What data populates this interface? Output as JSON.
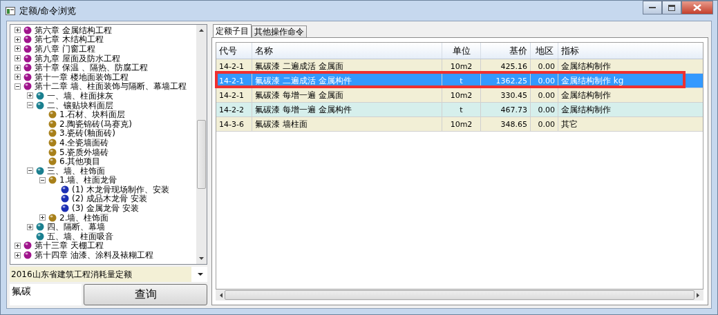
{
  "window": {
    "title": "定额/命令浏览"
  },
  "tree": [
    {
      "label": "第六章 金属结构工程",
      "kind": "chapter",
      "expanded": false
    },
    {
      "label": "第七章 木结构工程",
      "kind": "chapter",
      "expanded": false
    },
    {
      "label": "第八章 门窗工程",
      "kind": "chapter",
      "expanded": false
    },
    {
      "label": "第九章 屋面及防水工程",
      "kind": "chapter",
      "expanded": false
    },
    {
      "label": "第十章 保温 、隔热、防腐工程",
      "kind": "chapter",
      "expanded": false
    },
    {
      "label": "第十一章 楼地面装饰工程",
      "kind": "chapter",
      "expanded": false
    },
    {
      "label": "第十二章 墙、柱面装饰与隔断、幕墙工程",
      "kind": "chapter",
      "expanded": true,
      "children": [
        {
          "label": "一、墙、柱面抹灰",
          "kind": "section",
          "expanded": false
        },
        {
          "label": "二、镶贴块料面层",
          "kind": "section",
          "expanded": true,
          "children": [
            {
              "label": "1.石材、块料面层",
              "kind": "group"
            },
            {
              "label": "2.陶瓷锦砖(马赛克)",
              "kind": "group"
            },
            {
              "label": "3.瓷砖(釉面砖)",
              "kind": "group"
            },
            {
              "label": "4.全瓷墙面砖",
              "kind": "group"
            },
            {
              "label": "5.瓷质外墙砖",
              "kind": "group"
            },
            {
              "label": "6.其他项目",
              "kind": "group"
            }
          ]
        },
        {
          "label": "三、墙、柱饰面",
          "kind": "section",
          "expanded": true,
          "children": [
            {
              "label": "1.墙、柱面龙骨",
              "kind": "group",
              "expanded": true,
              "children": [
                {
                  "label": "(1) 木龙骨现场制作、安装",
                  "kind": "item"
                },
                {
                  "label": "(2) 成品木龙骨 安装",
                  "kind": "item"
                },
                {
                  "label": "(3) 金属龙骨 安装",
                  "kind": "item"
                }
              ]
            },
            {
              "label": "2.墙、柱饰面",
              "kind": "group",
              "expanded": false
            }
          ]
        },
        {
          "label": "四、隔断、幕墙",
          "kind": "section",
          "expanded": false
        },
        {
          "label": "五、墙、柱面吸音",
          "kind": "section"
        }
      ]
    },
    {
      "label": "第十三章 天棚工程",
      "kind": "chapter",
      "expanded": false
    },
    {
      "label": "第十四章 油漆、涂料及裱糊工程",
      "kind": "chapter",
      "expanded": false
    }
  ],
  "quota_dropdown": {
    "value": "2016山东省建筑工程消耗量定额"
  },
  "search": {
    "value": "氟碳"
  },
  "query_button": "查询",
  "tabs": [
    {
      "label": "定额子目",
      "selected": true
    },
    {
      "label": "其他操作命令",
      "selected": false
    }
  ],
  "table": {
    "columns": [
      "代号",
      "名称",
      "单位",
      "基价",
      "地区",
      "指标"
    ],
    "rows": [
      {
        "cells": [
          "14-2-1",
          "氟碳漆 二遍成活 金属面",
          "10m2",
          "425.16",
          "0.00",
          "金属结构制作"
        ],
        "selected": false,
        "color": "#f2efd6"
      },
      {
        "cells": [
          "14-2-1",
          "氟碳漆 二遍成活 金属构件",
          "t",
          "1362.25",
          "0.00",
          "金属结构制作 kg"
        ],
        "selected": true
      },
      {
        "cells": [
          "14-2-1",
          "氟碳漆 每增一遍 金属面",
          "10m2",
          "330.45",
          "0.00",
          "金属结构制作"
        ],
        "selected": false,
        "color": "#f2efd6"
      },
      {
        "cells": [
          "14-2-2",
          "氟碳漆 每增一遍 金属构件",
          "t",
          "467.73",
          "0.00",
          "金属结构制作"
        ],
        "selected": false,
        "color": "#d6efec"
      },
      {
        "cells": [
          "14-3-6",
          "氟碳漆 墙柱面",
          "10m2",
          "348.65",
          "0.00",
          "其它"
        ],
        "selected": false,
        "color": "#f2efd6"
      }
    ]
  }
}
